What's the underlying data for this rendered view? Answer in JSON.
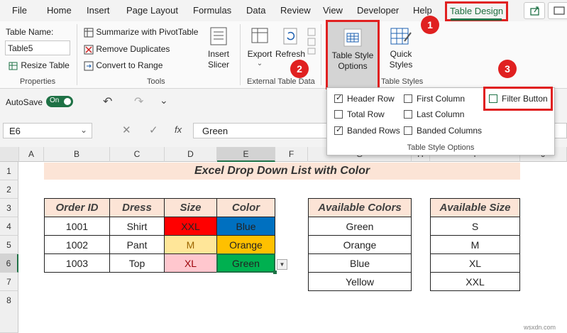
{
  "tabs": [
    "File",
    "Home",
    "Insert",
    "Page Layout",
    "Formulas",
    "Data",
    "Review",
    "View",
    "Developer",
    "Help"
  ],
  "active_tab": "Table Design",
  "ribbon": {
    "table_name_label": "Table Name:",
    "table_name_value": "Table5",
    "resize_table": "Resize Table",
    "group_properties": "Properties",
    "summarize_pivot": "Summarize with PivotTable",
    "remove_duplicates": "Remove Duplicates",
    "convert_to_range": "Convert to Range",
    "insert_slicer_1": "Insert",
    "insert_slicer_2": "Slicer",
    "group_tools": "Tools",
    "export": "Export",
    "refresh": "Refresh",
    "group_external": "External Table Data",
    "table_style_options_1": "Table Style",
    "table_style_options_2": "Options",
    "quick_styles_1": "Quick",
    "quick_styles_2": "Styles",
    "group_table_styles": "Table Styles"
  },
  "qat": {
    "autosave": "AutoSave",
    "toggle": "On"
  },
  "formula_bar": {
    "name_box": "E6",
    "fx": "fx",
    "value": "Green"
  },
  "columns": [
    "A",
    "B",
    "C",
    "D",
    "E",
    "F",
    "G",
    "H",
    "I",
    "J"
  ],
  "rows": [
    "1",
    "2",
    "3",
    "4",
    "5",
    "6",
    "7",
    "8"
  ],
  "sheet": {
    "title": "Excel Drop Down List with Color",
    "headers": [
      "Order ID",
      "Dress",
      "Size",
      "Color"
    ],
    "data": [
      [
        "1001",
        "Shirt",
        "XXL",
        "Blue"
      ],
      [
        "1002",
        "Pant",
        "M",
        "Orange"
      ],
      [
        "1003",
        "Top",
        "XL",
        "Green"
      ]
    ],
    "colors_header": "Available Colors",
    "colors": [
      "Green",
      "Orange",
      "Blue",
      "Yellow"
    ],
    "size_header": "Available Size",
    "sizes": [
      "S",
      "M",
      "XL",
      "XXL"
    ]
  },
  "style_options": {
    "header_row": "Header Row",
    "total_row": "Total Row",
    "banded_rows": "Banded Rows",
    "first_column": "First Column",
    "last_column": "Last Column",
    "banded_columns": "Banded Columns",
    "filter_button": "Filter Button",
    "footer": "Table Style Options"
  },
  "badges": [
    "1",
    "2",
    "3"
  ],
  "colors": {
    "accent_green": "#1e7145",
    "callout_red": "#e02020",
    "xxl_fill": "#ff0000",
    "blue_fill": "#0070c0",
    "m_fill": "#ffe699",
    "orange_fill": "#ffc000",
    "xl_fill": "#ffc7ce",
    "green_fill": "#00b050",
    "header_fill": "#fce4d6"
  }
}
